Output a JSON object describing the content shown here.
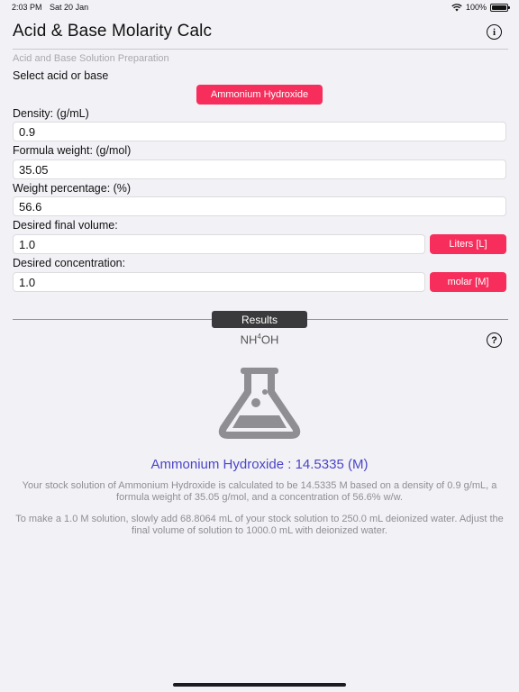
{
  "status_bar": {
    "time": "2:03 PM",
    "date": "Sat 20 Jan",
    "battery": "100%"
  },
  "nav": {
    "title": "Acid & Base Molarity Calc"
  },
  "subheader": "Acid and Base Solution Preparation",
  "select_label": "Select acid or base",
  "selected_compound": "Ammonium Hydroxide",
  "density": {
    "label": "Density:  (g/mL)",
    "value": "0.9"
  },
  "formula_weight": {
    "label": "Formula weight:  (g/mol)",
    "value": "35.05"
  },
  "weight_percentage": {
    "label": "Weight percentage:  (%)",
    "value": "56.6"
  },
  "final_volume": {
    "label": "Desired final volume:",
    "value": "1.0",
    "unit": "Liters [L]"
  },
  "concentration": {
    "label": "Desired concentration:",
    "value": "1.0",
    "unit": "molar [M]"
  },
  "results": {
    "tab_label": "Results",
    "formula_main": "NH",
    "formula_sub": "4",
    "formula_end": "OH",
    "title": "Ammonium Hydroxide : 14.5335 (M)",
    "paragraph1": "Your stock solution of Ammonium Hydroxide is calculated to be 14.5335 M based on a density of 0.9 g/mL, a formula weight of 35.05 g/mol, and a concentration of 56.6% w/w.",
    "paragraph2": "To make a 1.0 M solution, slowly add 68.8064 mL of your stock solution to 250.0 mL deionized water. Adjust the final volume of solution to 1000.0 mL with deionized water."
  },
  "icons": {
    "info": "info-icon",
    "help": "help-icon",
    "flask": "flask-icon",
    "wifi": "wifi-icon",
    "battery": "battery-icon"
  },
  "colors": {
    "accent": "#f72e5c",
    "result_title": "#4a45c8",
    "background": "#f2f1f6"
  }
}
